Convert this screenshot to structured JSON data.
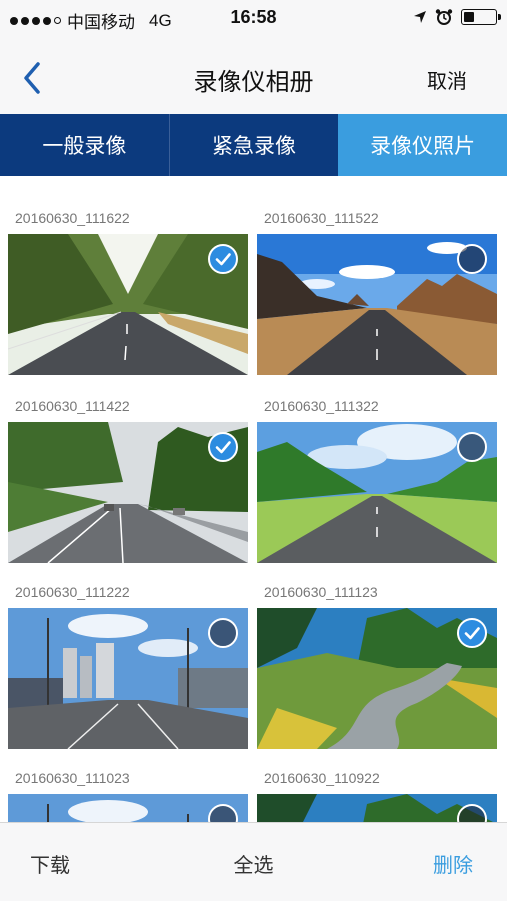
{
  "status": {
    "carrier": "中国移动",
    "network": "4G",
    "time": "16:58",
    "battery_level": 0.35
  },
  "nav": {
    "title": "录像仪相册",
    "cancel_label": "取消"
  },
  "tabs": [
    {
      "label": "一般录像",
      "active": false
    },
    {
      "label": "紧急录像",
      "active": false
    },
    {
      "label": "录像仪照片",
      "active": true
    }
  ],
  "photos": [
    {
      "name": "20160630_111622",
      "selected": true,
      "scene": "tree-lined-road"
    },
    {
      "name": "20160630_111522",
      "selected": false,
      "scene": "desert-mountain-road"
    },
    {
      "name": "20160630_111422",
      "selected": true,
      "scene": "forest-highway"
    },
    {
      "name": "20160630_111322",
      "selected": false,
      "scene": "meadow-road"
    },
    {
      "name": "20160630_111222",
      "selected": false,
      "scene": "city-street"
    },
    {
      "name": "20160630_111123",
      "selected": true,
      "scene": "winding-country-road"
    },
    {
      "name": "20160630_111023",
      "selected": false,
      "scene": "city-street"
    },
    {
      "name": "20160630_110922",
      "selected": false,
      "scene": "winding-country-road"
    }
  ],
  "toolbar": {
    "download_label": "下载",
    "select_all_label": "全选",
    "delete_label": "删除"
  },
  "colors": {
    "tab_bg": "#0c3a7e",
    "tab_active": "#3a9ddf",
    "accent": "#2d8ce0",
    "delete_text": "#3a9ddf"
  }
}
